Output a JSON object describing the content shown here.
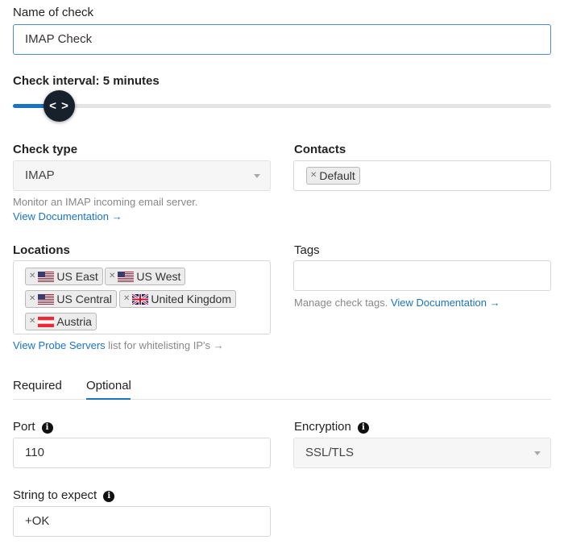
{
  "name_of_check": {
    "label": "Name of check",
    "value": "IMAP Check"
  },
  "check_interval": {
    "label": "Check interval: 5 minutes",
    "handle_glyph": "< >",
    "level_fraction": 0.06
  },
  "check_type": {
    "label": "Check type",
    "value": "IMAP",
    "help": "Monitor an IMAP incoming email server.",
    "doc_link": "View Documentation →"
  },
  "contacts": {
    "label": "Contacts",
    "tags": [
      "Default"
    ]
  },
  "locations": {
    "label": "Locations",
    "tags": [
      {
        "flag": "us-flag-icon",
        "label": "US East"
      },
      {
        "flag": "us-flag-icon",
        "label": "US West"
      },
      {
        "flag": "us-flag-icon",
        "label": "US Central"
      },
      {
        "flag": "uk-flag-icon",
        "label": "United Kingdom"
      },
      {
        "flag": "austria-flag-icon",
        "label": "Austria"
      }
    ],
    "probe_link": "View Probe Servers",
    "probe_help": " list for whitelisting IP's →"
  },
  "tags": {
    "label": "Tags",
    "help": "Manage check tags. ",
    "doc_link": "View Documentation →"
  },
  "tabs": [
    {
      "label": "Required",
      "active": false
    },
    {
      "label": "Optional",
      "active": true
    }
  ],
  "port": {
    "label": "Port",
    "value": "110"
  },
  "encryption": {
    "label": "Encryption",
    "value": "SSL/TLS"
  },
  "string_to_expect": {
    "label": "String to expect",
    "value": "+OK"
  },
  "colors": {
    "accent": "#1a74c6",
    "handle": "#17212b"
  }
}
